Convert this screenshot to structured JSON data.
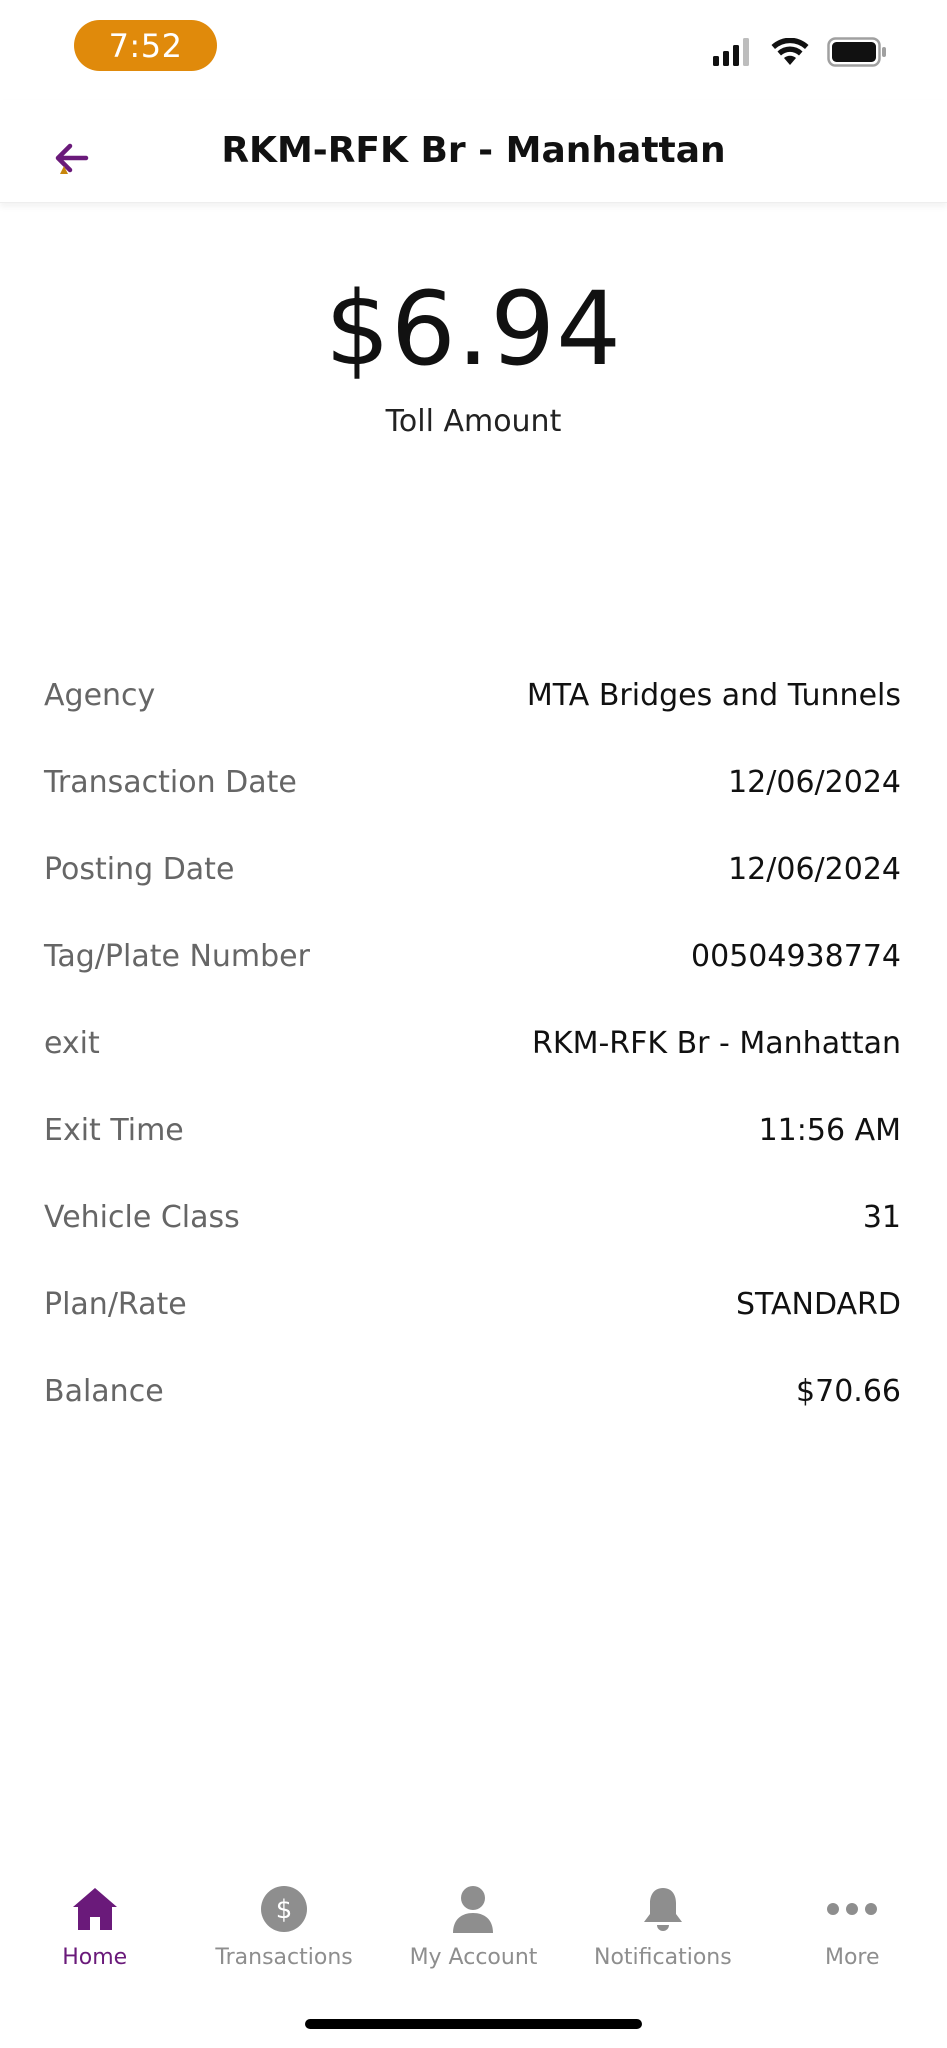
{
  "status_bar": {
    "time": "7:52",
    "time_pill_color": "#e08a0b"
  },
  "header": {
    "title": "RKM-RFK Br - Manhattan",
    "back_icon": "arrow-left-icon",
    "accent_color": "#6a1a7a"
  },
  "toll": {
    "amount": "$6.94",
    "label": "Toll Amount"
  },
  "details": [
    {
      "label": "Agency",
      "value": "MTA Bridges and Tunnels"
    },
    {
      "label": "Transaction Date",
      "value": "12/06/2024"
    },
    {
      "label": "Posting Date",
      "value": "12/06/2024"
    },
    {
      "label": "Tag/Plate Number",
      "value": "00504938774"
    },
    {
      "label": "exit",
      "value": "RKM-RFK Br - Manhattan"
    },
    {
      "label": "Exit Time",
      "value": "11:56 AM"
    },
    {
      "label": "Vehicle Class",
      "value": "31"
    },
    {
      "label": "Plan/Rate",
      "value": "STANDARD"
    },
    {
      "label": "Balance",
      "value": "$70.66"
    }
  ],
  "tabs": [
    {
      "label": "Home",
      "icon": "home-icon",
      "active": true
    },
    {
      "label": "Transactions",
      "icon": "dollar-circle-icon",
      "active": false
    },
    {
      "label": "My Account",
      "icon": "person-icon",
      "active": false
    },
    {
      "label": "Notifications",
      "icon": "bell-icon",
      "active": false
    },
    {
      "label": "More",
      "icon": "more-dots-icon",
      "active": false
    }
  ],
  "colors": {
    "active_tab": "#6a1a7a",
    "inactive_tab": "#8e8e8e"
  }
}
